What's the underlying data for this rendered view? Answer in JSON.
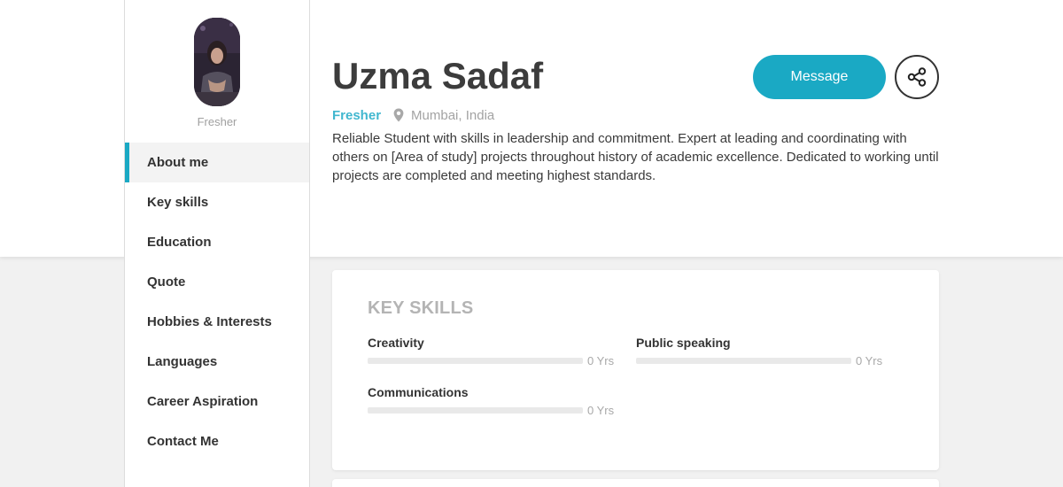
{
  "profile": {
    "name": "Uzma Sadaf",
    "status": "Fresher",
    "location": "Mumbai, India",
    "bio": "Reliable Student with skills in leadership and commitment. Expert at leading and coordinating with others on [Area of study] projects throughout history of academic excellence. Dedicated to working until projects are completed and meeting highest standards."
  },
  "sidebar": {
    "caption": "Fresher",
    "items": [
      {
        "label": "About me",
        "active": true
      },
      {
        "label": "Key skills"
      },
      {
        "label": "Education"
      },
      {
        "label": "Quote"
      },
      {
        "label": "Hobbies & Interests"
      },
      {
        "label": "Languages"
      },
      {
        "label": "Career Aspiration"
      },
      {
        "label": "Contact Me"
      }
    ]
  },
  "actions": {
    "message_label": "Message",
    "share_icon": "share-icon"
  },
  "key_skills": {
    "title": "KEY SKILLS",
    "skills": [
      {
        "name": "Creativity",
        "years": "0 Yrs",
        "level": 0
      },
      {
        "name": "Public speaking",
        "years": "0 Yrs",
        "level": 0
      },
      {
        "name": "Communications",
        "years": "0 Yrs",
        "level": 0
      }
    ]
  },
  "colors": {
    "accent": "#1aa9c4",
    "status_text": "#41b7cf",
    "page_bg": "#f1f1f1"
  }
}
